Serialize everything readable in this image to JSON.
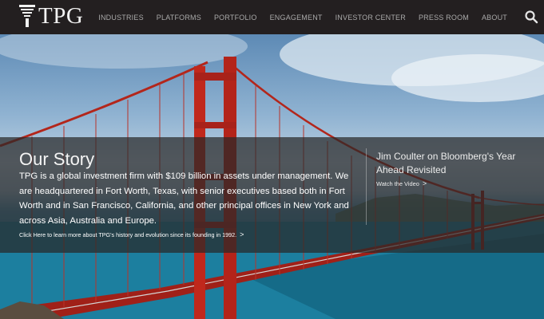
{
  "header": {
    "logo_text": "TPG",
    "nav": [
      {
        "label": "INDUSTRIES"
      },
      {
        "label": "PLATFORMS"
      },
      {
        "label": "PORTFOLIO"
      },
      {
        "label": "ENGAGEMENT"
      },
      {
        "label": "INVESTOR CENTER"
      },
      {
        "label": "PRESS ROOM"
      },
      {
        "label": "ABOUT"
      }
    ],
    "search_icon": "search-icon"
  },
  "hero": {
    "title": "Our Story",
    "body": "TPG is a global investment firm with $109 billion in assets under management. We are headquartered in Fort Worth, Texas, with senior executives based both in Fort Worth and in San Francisco, California, and other principal offices in New York and across Asia, Australia and Europe.",
    "link_label": "Click Here to learn more about TPG's history and evolution since its founding in 1992.",
    "side_title": "Jim Coulter on Bloomberg's Year Ahead Revisited",
    "side_link_label": "Watch the Video",
    "chevron": ">"
  },
  "colors": {
    "header_bg": "#231f20",
    "nav_text": "#a9a9a9",
    "bridge_red": "#c0281c",
    "band_bg": "rgba(40,40,40,0.72)"
  }
}
